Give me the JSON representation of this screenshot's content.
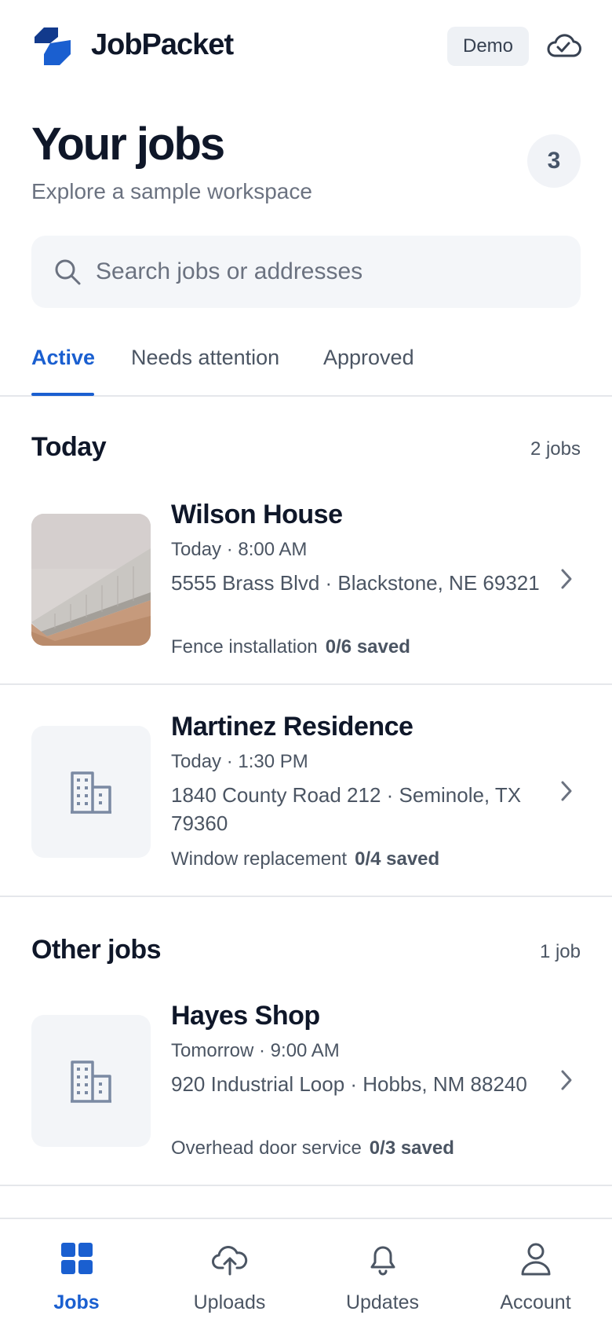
{
  "app": {
    "brand": "JobPacket",
    "demo_label": "Demo"
  },
  "header": {
    "title": "Your jobs",
    "subtitle": "Explore a sample workspace",
    "count": "3"
  },
  "search": {
    "placeholder": "Search jobs or addresses",
    "value": ""
  },
  "tabs": [
    {
      "label": "Active",
      "active": true
    },
    {
      "label": "Needs attention",
      "active": false
    },
    {
      "label": "Approved",
      "active": false
    }
  ],
  "sections": [
    {
      "title": "Today",
      "count": "2 jobs",
      "jobs": [
        {
          "name": "Wilson House",
          "time": "Today · 8:00 AM",
          "address": "5555 Brass Blvd · Blackstone, NE 69321",
          "type": "Fence installation",
          "saved": "0/6 saved",
          "thumbnail": "photo-fence"
        },
        {
          "name": "Martinez Residence",
          "time": "Today · 1:30 PM",
          "address": "1840 County Road 212 · Seminole, TX 79360",
          "type": "Window replacement",
          "saved": "0/4 saved",
          "thumbnail": "building-icon"
        }
      ]
    },
    {
      "title": "Other jobs",
      "count": "1 job",
      "jobs": [
        {
          "name": "Hayes Shop",
          "time": "Tomorrow · 9:00 AM",
          "address": "920 Industrial Loop · Hobbs, NM 88240",
          "type": "Overhead door service",
          "saved": "0/3 saved",
          "thumbnail": "building-icon"
        }
      ]
    }
  ],
  "bottom_nav": [
    {
      "label": "Jobs",
      "icon": "grid-icon",
      "active": true
    },
    {
      "label": "Uploads",
      "icon": "cloud-upload-icon",
      "active": false
    },
    {
      "label": "Updates",
      "icon": "bell-icon",
      "active": false
    },
    {
      "label": "Account",
      "icon": "person-icon",
      "active": false
    }
  ],
  "colors": {
    "accent": "#1a5fd0",
    "text": "#0f1729",
    "muted": "#4b5563",
    "divider": "#e5e7eb",
    "surface": "#f4f6f9"
  }
}
